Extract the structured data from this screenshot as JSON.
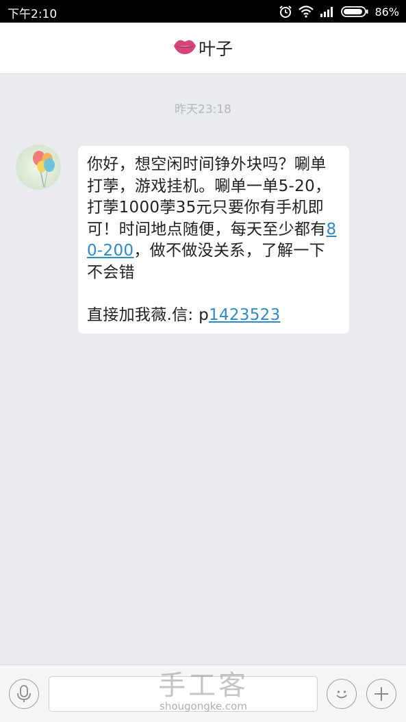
{
  "status_bar": {
    "time": "下午2:10",
    "battery": "86%",
    "icons": [
      "alarm-icon",
      "wifi-icon",
      "signal-icon",
      "battery-icon"
    ]
  },
  "header": {
    "contact_name": "叶子",
    "contact_icon": "lips-icon",
    "accent_color": "#d6457a"
  },
  "conversation": {
    "timestamp": "昨天23:18",
    "message": {
      "avatar_icon": "balloons-avatar",
      "part1": "你好，想空闲时间铮外块吗？唰单打荸，游戏挂机。唰单一单5-20，打荸1000荸35元只要你有手机即可！时间地点随便，每天至少都有",
      "link1": "80-200",
      "part2": "，做不做没关系，了解一下不会错",
      "part3": "直接加我薇.信: p",
      "link2": "1423523",
      "link_color": "#2f89c8"
    }
  },
  "input_bar": {
    "mic_icon": "microphone-icon",
    "text_value": "",
    "emoji_icon": "smiley-icon",
    "plus_icon": "plus-icon"
  },
  "watermark": {
    "cn": "手工客",
    "en": "shougongke.com"
  }
}
